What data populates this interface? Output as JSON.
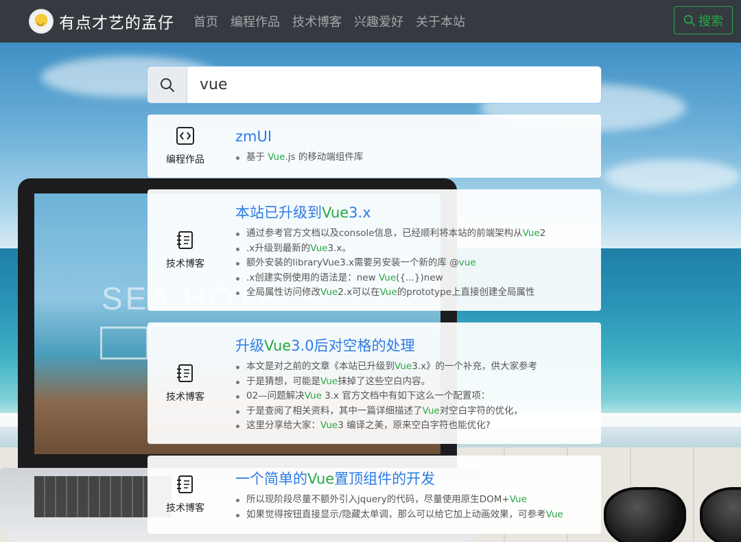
{
  "nav": {
    "brand": "有点才艺的孟仔",
    "links": [
      "首页",
      "编程作品",
      "技术博客",
      "兴趣爱好",
      "关于本站"
    ],
    "search_button": "搜索"
  },
  "colors": {
    "navbar": "#343a40",
    "accent_green": "#28a745",
    "title_blue": "#2c7be5"
  },
  "search": {
    "value": "vue"
  },
  "background": {
    "text": "SEA HOTELS"
  },
  "results": [
    {
      "category": "编程作品",
      "icon": "code-icon",
      "title": [
        {
          "t": "zmUI",
          "h": false
        }
      ],
      "lines": [
        [
          {
            "t": "基于 ",
            "h": false
          },
          {
            "t": "Vue",
            "h": true
          },
          {
            "t": ".js 的移动端组件库",
            "h": false
          }
        ]
      ]
    },
    {
      "category": "技术博客",
      "icon": "notebook-icon",
      "title": [
        {
          "t": "本站已升级到",
          "h": false
        },
        {
          "t": "Vue",
          "h": true
        },
        {
          "t": "3.x",
          "h": false
        }
      ],
      "lines": [
        [
          {
            "t": "通过参考官方文档以及console信息，已经顺利将本站的前端架构从",
            "h": false
          },
          {
            "t": "Vue",
            "h": true
          },
          {
            "t": "2",
            "h": false
          }
        ],
        [
          {
            "t": ".x升级到最新的",
            "h": false
          },
          {
            "t": "Vue",
            "h": true
          },
          {
            "t": "3.x。",
            "h": false
          }
        ],
        [
          {
            "t": "额外安装的libraryVue3.x需要另安装一个新的库 @",
            "h": false
          },
          {
            "t": "vue",
            "h": true
          }
        ],
        [
          {
            "t": ".x创建实例使用的语法是：new ",
            "h": false
          },
          {
            "t": "Vue",
            "h": true
          },
          {
            "t": "({...})new",
            "h": false
          }
        ],
        [
          {
            "t": "全局属性访问修改",
            "h": false
          },
          {
            "t": "Vue",
            "h": true
          },
          {
            "t": "2.x可以在",
            "h": false
          },
          {
            "t": "Vue",
            "h": true
          },
          {
            "t": "的prototype上直接创建全局属性",
            "h": false
          }
        ]
      ]
    },
    {
      "category": "技术博客",
      "icon": "notebook-icon",
      "title": [
        {
          "t": "升级",
          "h": false
        },
        {
          "t": "Vue",
          "h": true
        },
        {
          "t": "3.0后对空格的处理",
          "h": false
        }
      ],
      "lines": [
        [
          {
            "t": "本文是对之前的文章《本站已升级到",
            "h": false
          },
          {
            "t": "Vue",
            "h": true
          },
          {
            "t": "3.x》的一个补充，供大家参考",
            "h": false
          }
        ],
        [
          {
            "t": "于是猜想，可能是",
            "h": false
          },
          {
            "t": "Vue",
            "h": true
          },
          {
            "t": "抹掉了这些空白内容。",
            "h": false
          }
        ],
        [
          {
            "t": "02—问题解决",
            "h": false
          },
          {
            "t": "Vue",
            "h": true
          },
          {
            "t": " 3.x 官方文档中有如下这么一个配置项：",
            "h": false
          }
        ],
        [
          {
            "t": "于是查阅了相关资料，其中一篇详细描述了",
            "h": false
          },
          {
            "t": "Vue",
            "h": true
          },
          {
            "t": "对空白字符的优化，",
            "h": false
          }
        ],
        [
          {
            "t": "这里分享给大家：",
            "h": false
          },
          {
            "t": "Vue",
            "h": true
          },
          {
            "t": "3 编译之美，原来空白字符也能优化?",
            "h": false
          }
        ]
      ]
    },
    {
      "category": "技术博客",
      "icon": "notebook-icon",
      "title": [
        {
          "t": "一个简单的",
          "h": false
        },
        {
          "t": "Vue",
          "h": true
        },
        {
          "t": "置顶组件的开发",
          "h": false
        }
      ],
      "lines": [
        [
          {
            "t": "所以现阶段尽量不额外引入jquery的代码，尽量使用原生DOM+",
            "h": false
          },
          {
            "t": "Vue",
            "h": true
          }
        ],
        [
          {
            "t": "如果觉得按钮直接显示/隐藏太单调，那么可以给它加上动画效果，可参考",
            "h": false
          },
          {
            "t": "Vue",
            "h": true
          }
        ]
      ]
    }
  ]
}
